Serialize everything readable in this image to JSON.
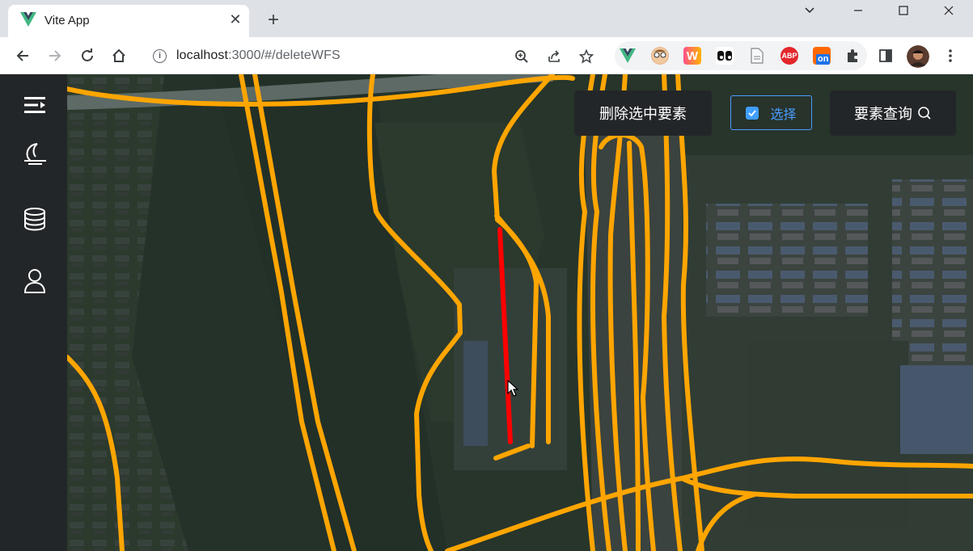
{
  "browser": {
    "tab_title": "Vite App",
    "url_host": "localhost",
    "url_rest": ":3000/#/deleteWFS"
  },
  "extensions": [
    {
      "name": "vue-devtools-extension",
      "label": ""
    },
    {
      "name": "avatar-extension",
      "label": ""
    },
    {
      "name": "w-extension",
      "label": "W"
    },
    {
      "name": "eyes-extension",
      "label": ""
    },
    {
      "name": "document-extension",
      "label": ""
    },
    {
      "name": "adblock-plus-extension",
      "label": "ABP"
    },
    {
      "name": "toggle-extension",
      "label": "on"
    }
  ],
  "toolbar": {
    "delete_label": "删除选中要素",
    "select_label": "选择",
    "select_checked": true,
    "query_label": "要素查询"
  },
  "map": {
    "road_color": "#ffa500",
    "selected_color": "#ff0000"
  }
}
